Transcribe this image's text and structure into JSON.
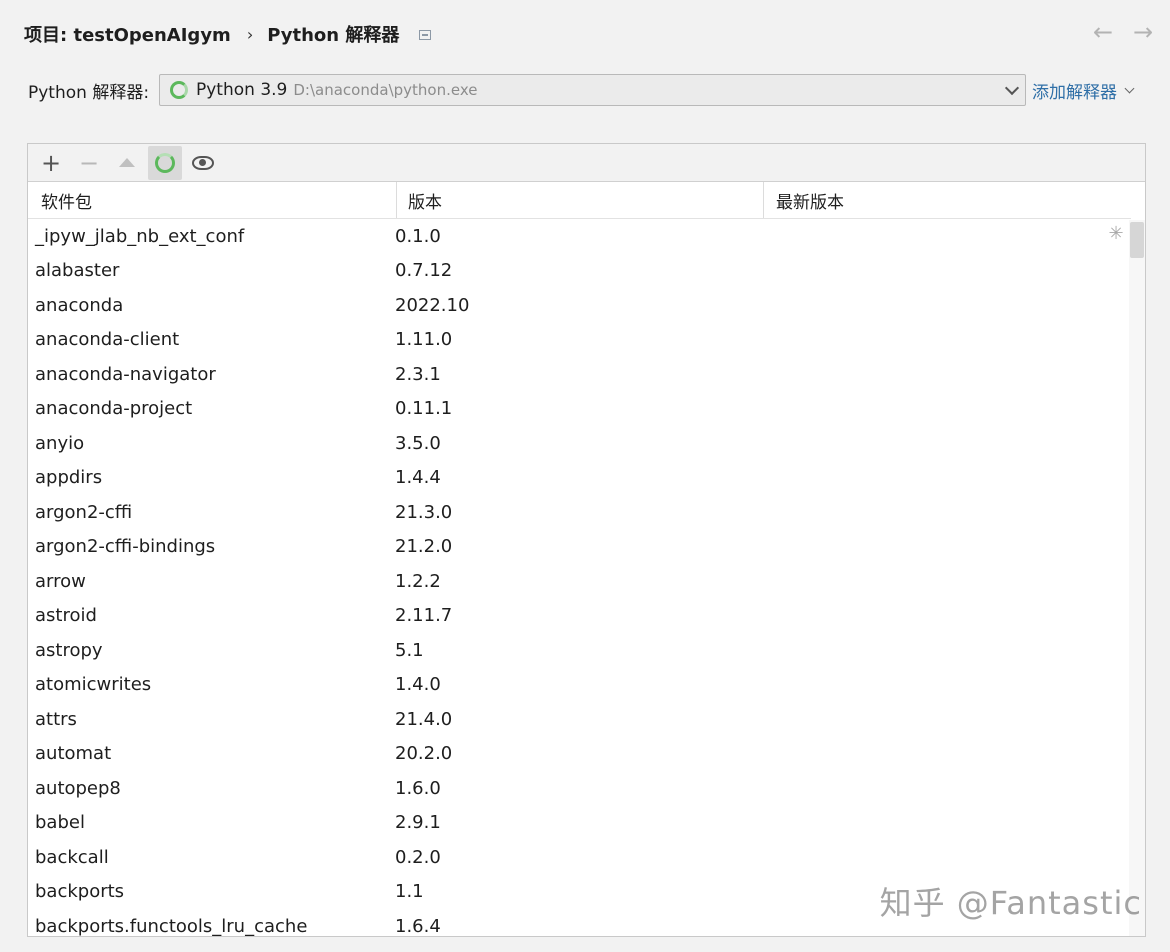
{
  "breadcrumb": {
    "project": "项目: testOpenAIgym",
    "separator": "›",
    "page": "Python 解释器"
  },
  "nav": {
    "back": "←",
    "forward": "→"
  },
  "interpreter": {
    "label": "Python 解释器:",
    "name": "Python 3.9",
    "path": "D:\\anaconda\\python.exe",
    "add_label": "添加解释器"
  },
  "toolbar": {
    "add": "+",
    "remove": "−"
  },
  "table": {
    "headers": [
      "软件包",
      "版本",
      "最新版本"
    ],
    "rows": [
      {
        "name": "_ipyw_jlab_nb_ext_conf",
        "version": "0.1.0",
        "latest": ""
      },
      {
        "name": "alabaster",
        "version": "0.7.12",
        "latest": ""
      },
      {
        "name": "anaconda",
        "version": "2022.10",
        "latest": ""
      },
      {
        "name": "anaconda-client",
        "version": "1.11.0",
        "latest": ""
      },
      {
        "name": "anaconda-navigator",
        "version": "2.3.1",
        "latest": ""
      },
      {
        "name": "anaconda-project",
        "version": "0.11.1",
        "latest": ""
      },
      {
        "name": "anyio",
        "version": "3.5.0",
        "latest": ""
      },
      {
        "name": "appdirs",
        "version": "1.4.4",
        "latest": ""
      },
      {
        "name": "argon2-cffi",
        "version": "21.3.0",
        "latest": ""
      },
      {
        "name": "argon2-cffi-bindings",
        "version": "21.2.0",
        "latest": ""
      },
      {
        "name": "arrow",
        "version": "1.2.2",
        "latest": ""
      },
      {
        "name": "astroid",
        "version": "2.11.7",
        "latest": ""
      },
      {
        "name": "astropy",
        "version": "5.1",
        "latest": ""
      },
      {
        "name": "atomicwrites",
        "version": "1.4.0",
        "latest": ""
      },
      {
        "name": "attrs",
        "version": "21.4.0",
        "latest": ""
      },
      {
        "name": "automat",
        "version": "20.2.0",
        "latest": ""
      },
      {
        "name": "autopep8",
        "version": "1.6.0",
        "latest": ""
      },
      {
        "name": "babel",
        "version": "2.9.1",
        "latest": ""
      },
      {
        "name": "backcall",
        "version": "0.2.0",
        "latest": ""
      },
      {
        "name": "backports",
        "version": "1.1",
        "latest": ""
      },
      {
        "name": "backports.functools_lru_cache",
        "version": "1.6.4",
        "latest": ""
      }
    ]
  },
  "watermark": "知乎 @Fantastic",
  "colors": {
    "accent_link": "#2f6fa7",
    "spinner_green": "#5cb85c",
    "background": "#f2f2f2"
  }
}
